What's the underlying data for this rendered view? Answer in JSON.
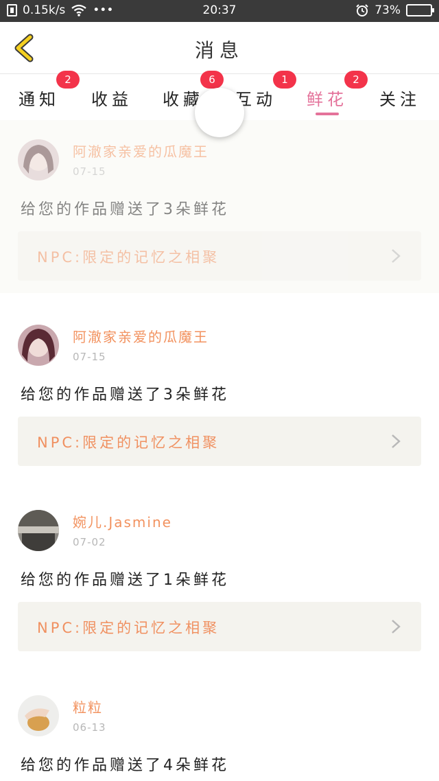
{
  "status_bar": {
    "network_speed": "0.15k/s",
    "dots": "•••",
    "time": "20:37",
    "battery_percent": "73%",
    "battery_level": 0.73
  },
  "header": {
    "title": "消息",
    "back_icon": "chevron-left-icon"
  },
  "tabs": [
    {
      "label": "通知",
      "badge": "2",
      "active": false
    },
    {
      "label": "收益",
      "badge": "",
      "active": false
    },
    {
      "label": "收藏",
      "badge": "6",
      "active": false
    },
    {
      "label": "互动",
      "badge": "1",
      "active": false
    },
    {
      "label": "鲜花",
      "badge": "2",
      "active": true
    },
    {
      "label": "关注",
      "badge": "",
      "active": false
    }
  ],
  "messages": [
    {
      "username": "阿澈家亲爱的瓜魔王",
      "date": "07-15",
      "text": "给您的作品赠送了3朵鲜花",
      "work_title": "NPC:限定的记忆之相聚"
    },
    {
      "username": "阿澈家亲爱的瓜魔王",
      "date": "07-15",
      "text": "给您的作品赠送了3朵鲜花",
      "work_title": "NPC:限定的记忆之相聚"
    },
    {
      "username": "婉儿.Jasmine",
      "date": "07-02",
      "text": "给您的作品赠送了1朵鲜花",
      "work_title": "NPC:限定的记忆之相聚"
    },
    {
      "username": "粒粒",
      "date": "06-13",
      "text": "给您的作品赠送了4朵鲜花",
      "work_title": ""
    }
  ],
  "colors": {
    "accent": "#e4729a",
    "badge": "#f3334a",
    "username": "#f2925f",
    "back_icon": "#f5d020"
  }
}
